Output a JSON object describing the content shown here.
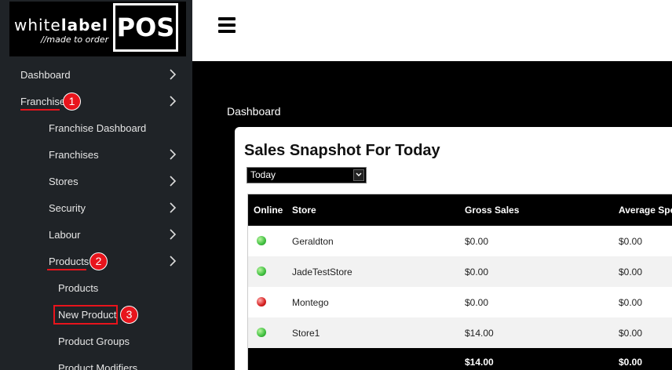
{
  "brand": {
    "name_light": "white",
    "name_bold": "label",
    "tagline": "//made to order",
    "box_text": "POS"
  },
  "sidebar": {
    "items": [
      {
        "label": "Dashboard"
      },
      {
        "label": "Franchise"
      },
      {
        "label": "Franchise Dashboard"
      },
      {
        "label": "Franchises"
      },
      {
        "label": "Stores"
      },
      {
        "label": "Security"
      },
      {
        "label": "Labour"
      },
      {
        "label": "Products"
      },
      {
        "label": "Products"
      },
      {
        "label": "New Product"
      },
      {
        "label": "Product Groups"
      },
      {
        "label": "Product Modifiers"
      }
    ],
    "badges": [
      "1",
      "2",
      "3"
    ]
  },
  "main": {
    "breadcrumb": "Dashboard",
    "card_title": "Sales Snapshot For Today",
    "period_select": "Today",
    "table": {
      "headers": [
        "Online",
        "Store",
        "Gross Sales",
        "Average Spe"
      ],
      "rows": [
        {
          "status": "online",
          "store": "Geraldton",
          "gross": "$0.00",
          "avg": "$0.00"
        },
        {
          "status": "online",
          "store": "JadeTestStore",
          "gross": "$0.00",
          "avg": "$0.00"
        },
        {
          "status": "offline",
          "store": "Montego",
          "gross": "$0.00",
          "avg": "$0.00"
        },
        {
          "status": "online",
          "store": "Store1",
          "gross": "$14.00",
          "avg": "$0.00"
        }
      ],
      "totals": {
        "gross": "$14.00",
        "avg": "$0.00"
      }
    }
  },
  "colors": {
    "sidebar_bg": "#1f2327",
    "annotation_red": "#e8141c",
    "online_green": "#3fbf3f",
    "offline_red": "#d61f1f"
  }
}
